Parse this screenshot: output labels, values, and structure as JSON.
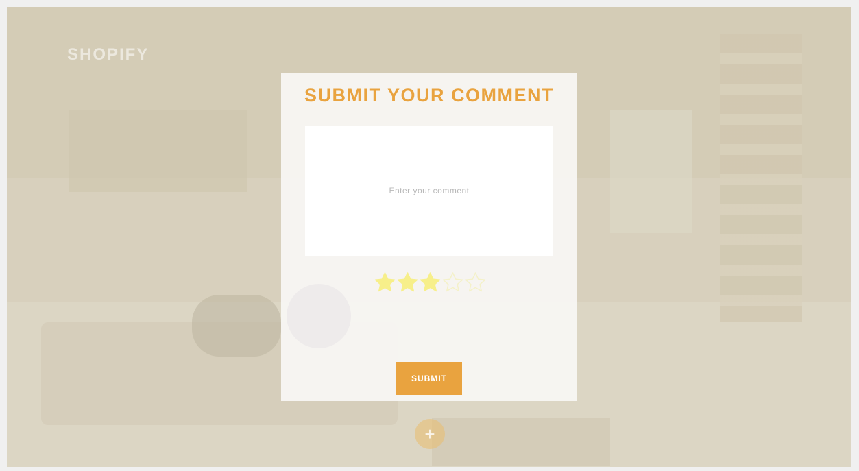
{
  "brand": {
    "logo_text": "SHOPIFY"
  },
  "modal": {
    "title": "SUBMIT YOUR COMMENT",
    "comment_placeholder": "Enter your comment",
    "rating": {
      "value": 3,
      "max": 5,
      "filled_color": "#f7ef8a",
      "empty_color": "#f4f1c8"
    },
    "submit_label": "SUBMIT"
  },
  "fab": {
    "label": "+",
    "icon": "plus-icon"
  },
  "colors": {
    "accent": "#e9a33f",
    "background": "#cfc7b2"
  }
}
